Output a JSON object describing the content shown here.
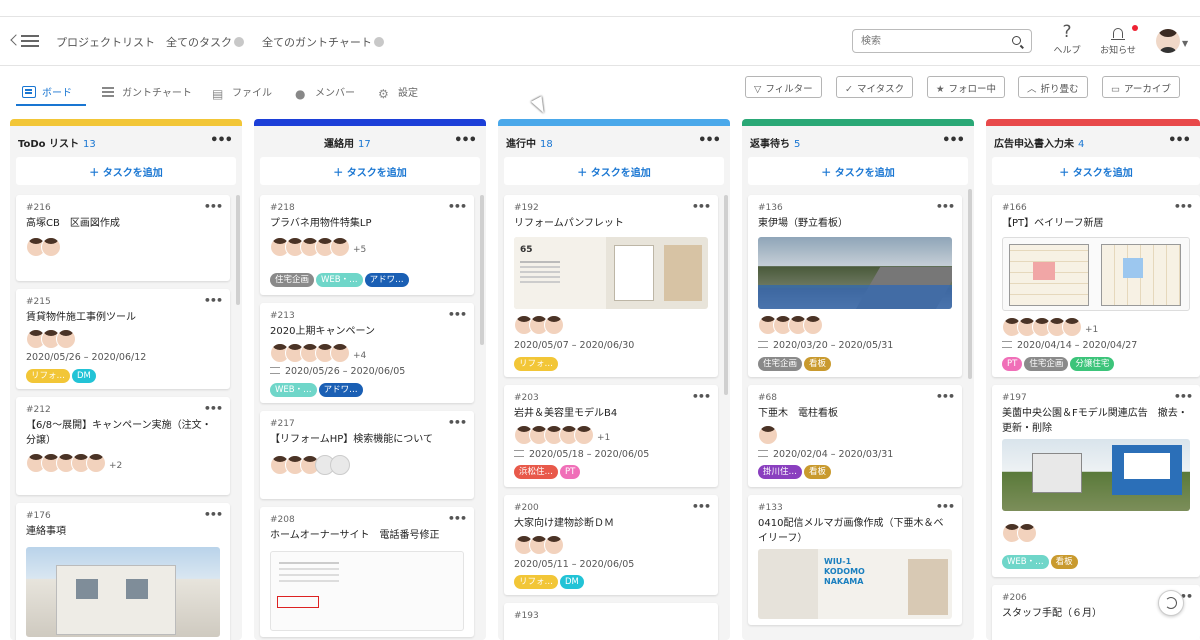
{
  "top_nav": {
    "project_list": "プロジェクトリスト",
    "all_tasks": "全てのタスク",
    "all_gantt": "全てのガントチャート",
    "search_placeholder": "検索",
    "help": "ヘルプ",
    "notices": "お知らせ"
  },
  "sub_tabs": {
    "board": "ボード",
    "gantt": "ガントチャート",
    "files": "ファイル",
    "members": "メンバー",
    "settings": "設定"
  },
  "actions": {
    "filter": "フィルター",
    "my_tasks": "マイタスク",
    "following": "フォロー中",
    "collapse": "折り畳む",
    "archive": "アーカイブ"
  },
  "add_task": "タスクを追加",
  "columns": [
    {
      "name": "ToDo リスト",
      "count": "13",
      "color": "#f2c637",
      "cards": [
        {
          "id": "#216",
          "title": "高塚CB　区画図作成"
        },
        {
          "id": "#215",
          "title": "賃貸物件施工事例ツール",
          "dates": "2020/05/26 – 2020/06/12",
          "tags": [
            {
              "label": "リフォ…",
              "color": "#f2c637"
            },
            {
              "label": "DM",
              "color": "#22c3d6"
            }
          ]
        },
        {
          "id": "#212",
          "title": "【6/8～展開】キャンペーン実施（注文・分譲）",
          "more": "+2"
        },
        {
          "id": "#176",
          "title": "連絡事項"
        }
      ]
    },
    {
      "name": "運絡用",
      "count": "17",
      "color": "#1c3fd8",
      "cards": [
        {
          "id": "#218",
          "title": "プラバネ用物件特集LP",
          "more": "+5",
          "tags": [
            {
              "label": "住宅企画",
              "color": "#8a8a8a"
            },
            {
              "label": "WEB・…",
              "color": "#6fd6c9"
            },
            {
              "label": "アドワ…",
              "color": "#1a5fb4"
            }
          ]
        },
        {
          "id": "#213",
          "title": "2020上期キャンペーン",
          "more": "+4",
          "dates": "2020/05/26 – 2020/06/05",
          "tags": [
            {
              "label": "WEB・…",
              "color": "#6fd6c9"
            },
            {
              "label": "アドワ…",
              "color": "#1a5fb4"
            }
          ]
        },
        {
          "id": "#217",
          "title": "【リフォームHP】検索機能について"
        },
        {
          "id": "#208",
          "title": "ホームオーナーサイト　電話番号修正"
        }
      ]
    },
    {
      "name": "進行中",
      "count": "18",
      "color": "#4aa8ea",
      "cards": [
        {
          "id": "#192",
          "title": "リフォームパンフレット",
          "dates": "2020/05/07 – 2020/06/30",
          "tags": [
            {
              "label": "リフォ…",
              "color": "#f2c637"
            }
          ],
          "photo_text": "65"
        },
        {
          "id": "#203",
          "title": "岩井＆美容里モデルB4",
          "more": "+1",
          "dates": "2020/05/18 – 2020/06/05",
          "tags": [
            {
              "label": "浜松住…",
              "color": "#e8594a"
            },
            {
              "label": "PT",
              "color": "#f06fb8"
            }
          ]
        },
        {
          "id": "#200",
          "title": "大家向け建物診断ＤＭ",
          "dates": "2020/05/11 – 2020/06/05",
          "tags": [
            {
              "label": "リフォ…",
              "color": "#f2c637"
            },
            {
              "label": "DM",
              "color": "#22c3d6"
            }
          ]
        },
        {
          "id": "#193",
          "title": ""
        }
      ]
    },
    {
      "name": "返事待ち",
      "count": "5",
      "color": "#2aa876",
      "cards": [
        {
          "id": "#136",
          "title": "東伊場（野立看板）",
          "dates": "2020/03/20 – 2020/05/31",
          "tags": [
            {
              "label": "住宅企画",
              "color": "#8a8a8a"
            },
            {
              "label": "看板",
              "color": "#c99a2e"
            }
          ]
        },
        {
          "id": "#68",
          "title": "下亜木　電柱看板",
          "dates": "2020/02/04 – 2020/03/31",
          "tags": [
            {
              "label": "掛川住…",
              "color": "#8a3fbf"
            },
            {
              "label": "看板",
              "color": "#c99a2e"
            }
          ]
        },
        {
          "id": "#133",
          "title": "0410配信メルマガ画像作成（下亜木＆ベイリーフ）",
          "photo_text": "WIU-1 KODOMO NAKAMA"
        }
      ]
    },
    {
      "name": "広告申込書入力未",
      "count": "4",
      "color": "#e8494a",
      "cards": [
        {
          "id": "#166",
          "title": "【PT】ベイリーフ新居",
          "more": "+1",
          "dates": "2020/04/14 – 2020/04/27",
          "tags": [
            {
              "label": "PT",
              "color": "#f06fb8"
            },
            {
              "label": "住宅企画",
              "color": "#8a8a8a"
            },
            {
              "label": "分譲住宅",
              "color": "#3cc47a"
            }
          ]
        },
        {
          "id": "#197",
          "title": "美薗中央公園＆Fモデル関連広告　撤去・更新・削除",
          "tags": [
            {
              "label": "WEB・…",
              "color": "#6fd6c9"
            },
            {
              "label": "看板",
              "color": "#c99a2e"
            }
          ]
        },
        {
          "id": "#206",
          "title": "スタッフ手配（６月）"
        }
      ]
    }
  ]
}
